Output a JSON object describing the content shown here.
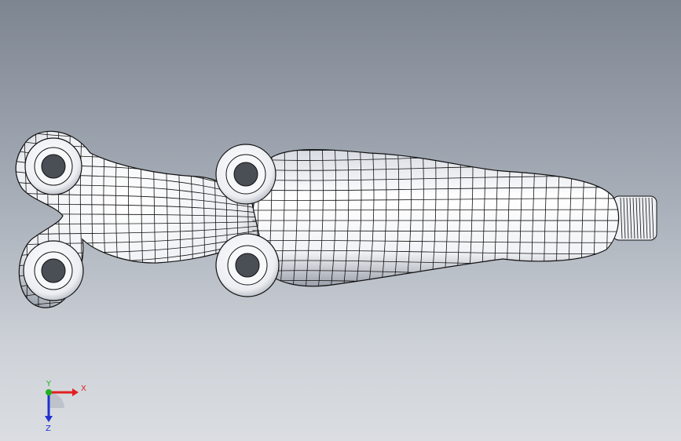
{
  "viewport": {
    "background_top": "#7d8591",
    "background_bottom": "#dadde1"
  },
  "model": {
    "surface_color": "#ffffff",
    "shade_color": "#9aa0aa",
    "mesh_color": "#111111",
    "hole_color": "#4a4e55"
  },
  "triad": {
    "x_label": "X",
    "y_label": "Y",
    "z_label": "Z",
    "x_color": "#e02020",
    "y_color": "#20b020",
    "z_color": "#2030d0"
  }
}
